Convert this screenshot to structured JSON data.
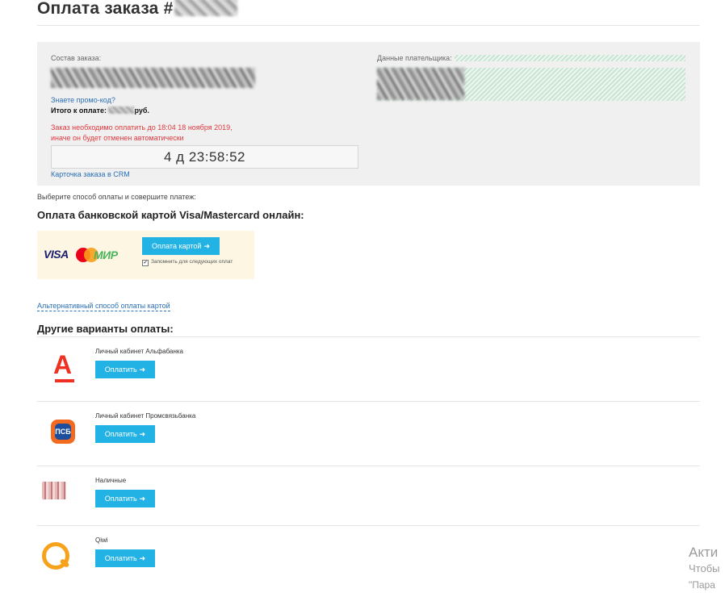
{
  "header": {
    "title": "Оплата заказа #"
  },
  "order": {
    "composition_label": "Состав заказа:",
    "payer_label": "Данные плательщика:",
    "promo_link": "Знаете промо-код?",
    "total_label": "Итого к оплате:",
    "total_currency": "руб.",
    "warning_line1": "Заказ необходимо оплатить до 18:04 18 ноября 2019,",
    "warning_line2": "иначе он будет отменен автоматически",
    "timer": "4 д 23:58:52",
    "crm_link": "Карточка заказа в CRM"
  },
  "choose_text": "Выберите способ оплаты и совершите платеж:",
  "card_section": {
    "title": "Оплата банковской картой Visa/Mastercard онлайн:",
    "visa_logo": "VISA",
    "mir_logo": "МИР",
    "pay_button": "Оплата картой",
    "remember_label": "Запомнить для следующих оплат",
    "remember_checked": "✔"
  },
  "alt_card_link": "Альтернативный способ оплаты картой",
  "other_section": {
    "title": "Другие варианты оплаты:",
    "options": [
      {
        "label": "Личный кабинет Альфабанка",
        "button": "Оплатить",
        "icon": "alfabank-logo-icon"
      },
      {
        "label": "Личный кабинет Промсвязьбанка",
        "button": "Оплатить",
        "icon": "psb-logo-icon"
      },
      {
        "label": "Наличные",
        "button": "Оплатить",
        "icon": "cash-icon"
      },
      {
        "label": "Qiwi",
        "button": "Оплатить",
        "icon": "qiwi-logo-icon"
      }
    ]
  },
  "alfa_letter": "А",
  "psb_glyph": "ПСБ",
  "arrow_glyph": "➜",
  "watermark": {
    "line1": "Акти",
    "line2": "Чтобы",
    "line3": "\"Пара"
  },
  "colors": {
    "accent_button": "#22b2e3",
    "warning": "#e0393e",
    "link": "#2a6fb6"
  }
}
